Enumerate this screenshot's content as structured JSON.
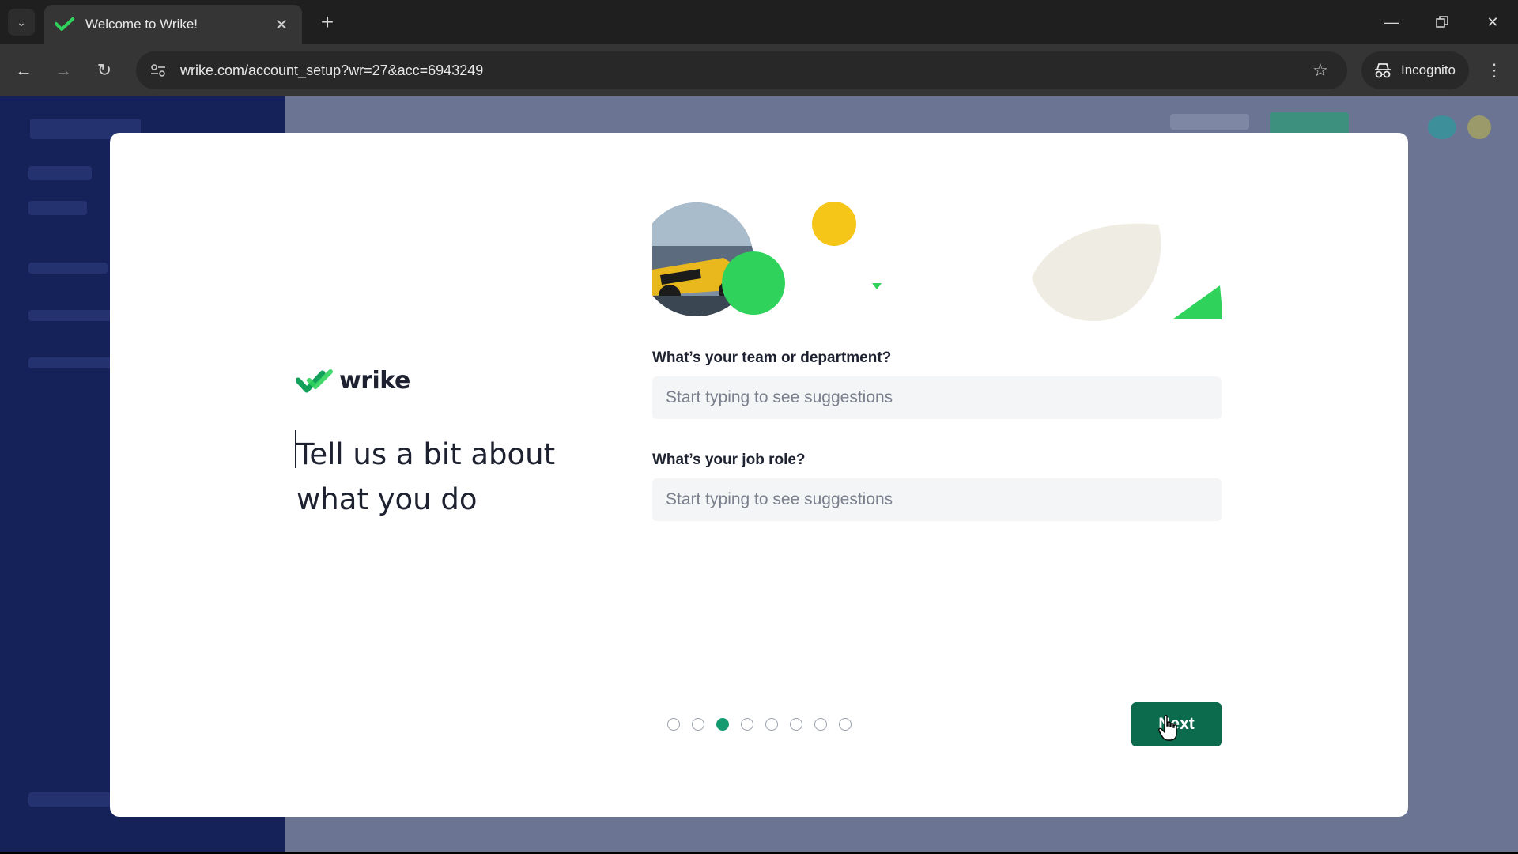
{
  "browser": {
    "tab_title": "Welcome to Wrike!",
    "url": "wrike.com/account_setup?wr=27&acc=6943249",
    "incognito_label": "Incognito"
  },
  "modal": {
    "logo_text": "wrike",
    "heading": "Tell us a bit about what you do",
    "fields": [
      {
        "label": "What’s your team or department?",
        "placeholder": "Start typing to see suggestions",
        "value": ""
      },
      {
        "label": "What’s your job role?",
        "placeholder": "Start typing to see suggestions",
        "value": ""
      }
    ],
    "progress": {
      "total_steps": 8,
      "current_step": 3
    },
    "next_label": "Next"
  },
  "colors": {
    "brand_green": "#0c6b4c",
    "accent_green": "#2fd35c",
    "accent_yellow": "#f5c518",
    "backdrop": "#6b7593"
  },
  "icons": [
    "tab-search-icon",
    "wrike-favicon-icon",
    "close-icon",
    "plus-icon",
    "minimize-icon",
    "restore-icon",
    "window-close-icon",
    "back-arrow-icon",
    "forward-arrow-icon",
    "reload-icon",
    "site-settings-icon",
    "star-icon",
    "incognito-icon",
    "kebab-menu-icon",
    "wrike-logo-icon",
    "mouse-pointer-icon"
  ]
}
